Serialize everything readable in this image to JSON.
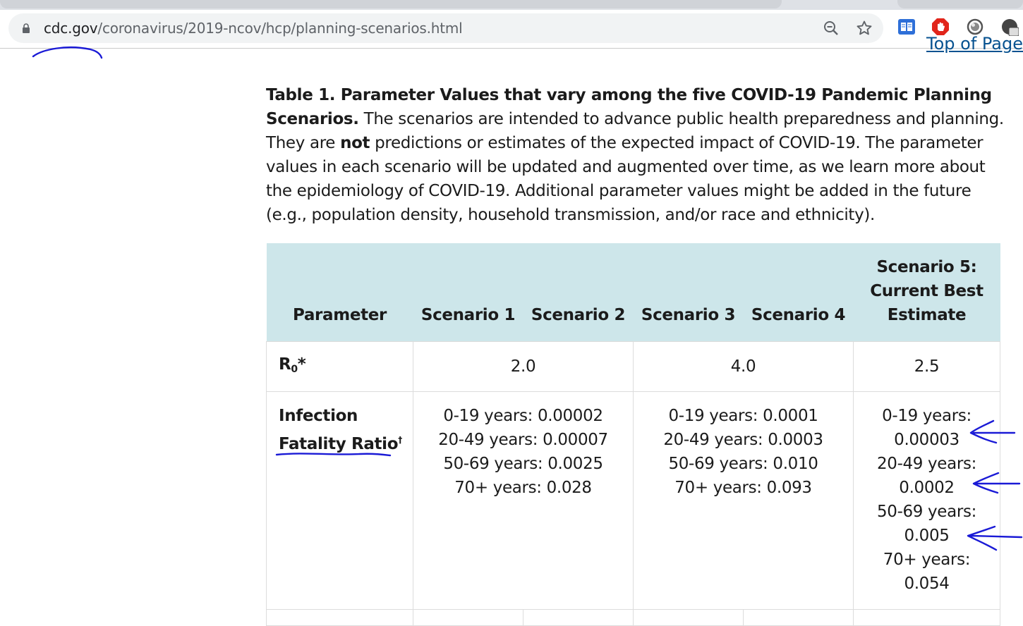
{
  "browser": {
    "url_host": "cdc.gov",
    "url_path": "/coronavirus/2019-ncov/hcp/planning-scenarios.html",
    "icons": [
      "lock-icon",
      "zoom-out-icon",
      "star-icon",
      "reader-extension-icon",
      "adblock-extension-icon",
      "circle-extension-icon"
    ]
  },
  "page": {
    "top_link": "Top of Page",
    "intro": {
      "title": "Table 1. Parameter Values that vary among the five COVID-19 Pandemic Planning Scenarios.",
      "text_1": " The scenarios are intended to advance public health preparedness and planning.  They are ",
      "text_bold": "not",
      "text_2": " predictions or estimates of the expected impact of COVID-19.  The parameter values in each scenario will be updated and augmented over time, as we learn more about the epidemiology of COVID-19.  Additional parameter values might be added in the future (e.g., population density, household transmission, and/or race and ethnicity)."
    },
    "table": {
      "headers": {
        "parameter": "Parameter",
        "s1": "Scenario 1",
        "s2": "Scenario 2",
        "s3": "Scenario 3",
        "s4": "Scenario 4",
        "s5_line1": "Scenario 5:",
        "s5_line2": "Current Best",
        "s5_line3": "Estimate"
      },
      "r0": {
        "label": "R",
        "label_sub": "0",
        "label_mark": "*",
        "s12": "2.0",
        "s34": "4.0",
        "s5": "2.5"
      },
      "ifr": {
        "label_line1": "Infection",
        "label_line2": "Fatality Ratio",
        "label_mark": "†",
        "s12": [
          "0-19 years: 0.00002",
          "20-49 years: 0.00007",
          "50-69 years: 0.0025",
          "70+ years: 0.028"
        ],
        "s34": [
          "0-19 years: 0.0001",
          "20-49 years: 0.0003",
          "50-69 years: 0.010",
          "70+ years: 0.093"
        ],
        "s5": [
          "0-19 years:",
          "0.00003",
          "20-49 years:",
          "0.0002",
          "50-69 years:",
          "0.005",
          "70+ years:",
          "0.054"
        ]
      }
    }
  },
  "colors": {
    "header_bg": "#cde6ea",
    "annotation_ink": "#1a1ad6",
    "link": "#075290"
  }
}
